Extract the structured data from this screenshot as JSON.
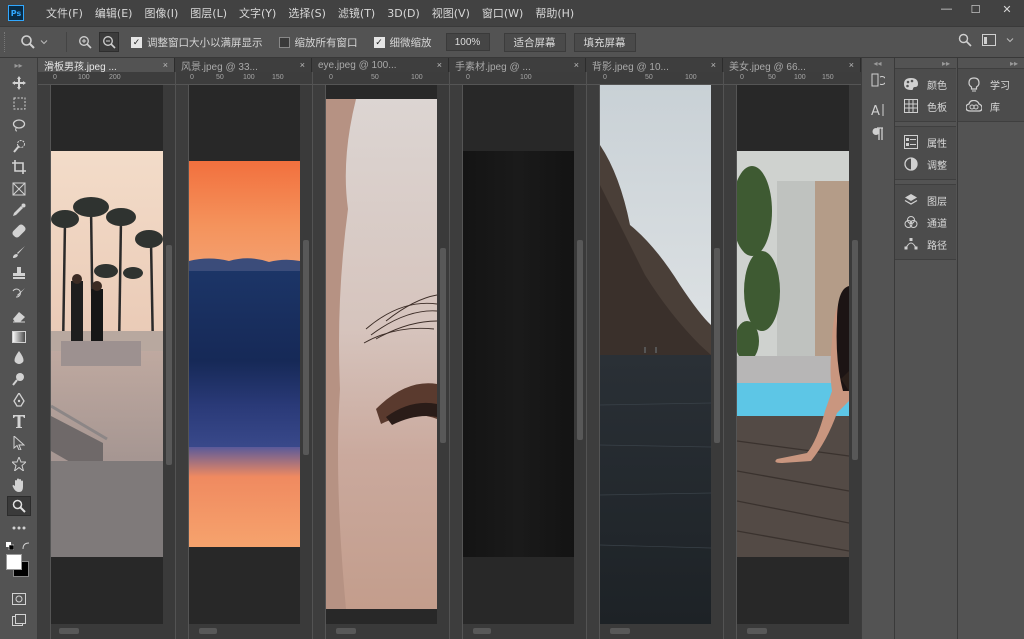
{
  "app": {
    "logo": "Ps"
  },
  "menu": [
    "文件(F)",
    "编辑(E)",
    "图像(I)",
    "图层(L)",
    "文字(Y)",
    "选择(S)",
    "滤镜(T)",
    "3D(D)",
    "视图(V)",
    "窗口(W)",
    "帮助(H)"
  ],
  "window_controls": {
    "minimize": "—",
    "maximize": "☐",
    "close": "✕"
  },
  "options": {
    "resize_windows_label": "调整窗口大小以满屏显示",
    "resize_windows_checked": true,
    "zoom_all_label": "缩放所有窗口",
    "zoom_all_checked": false,
    "scrubby_zoom_label": "细微缩放",
    "scrubby_zoom_checked": true,
    "zoom_value": "100%",
    "fit_screen": "适合屏幕",
    "fill_screen": "填充屏幕"
  },
  "tabs": [
    {
      "label": "滑板男孩.jpeg ...",
      "close": "×",
      "active": true
    },
    {
      "label": "风景.jpeg @ 33...",
      "close": "×",
      "active": false
    },
    {
      "label": "eye.jpeg @ 100...",
      "close": "×",
      "active": false
    },
    {
      "label": "手素材.jpeg @ ...",
      "close": "×",
      "active": false
    },
    {
      "label": "背影.jpeg @ 10...",
      "close": "×",
      "active": false
    },
    {
      "label": "美女.jpeg @ 66...",
      "close": "×",
      "active": false
    }
  ],
  "rulers": {
    "pane1": [
      "0",
      "100",
      "200"
    ],
    "pane2": [
      "0",
      "50",
      "100",
      "150"
    ],
    "pane3": [
      "0",
      "50",
      "100"
    ],
    "pane4": [
      "0",
      "100"
    ],
    "pane5": [
      "0",
      "50",
      "100"
    ],
    "pane6": [
      "0",
      "50",
      "100",
      "150"
    ]
  },
  "panels": {
    "column1": [
      "颜色",
      "色板",
      "属性",
      "调整",
      "图层",
      "通道",
      "路径"
    ],
    "column2": [
      "学习",
      "库"
    ]
  },
  "colors": {
    "accent": "#31a8ff",
    "panel_bg": "#535353",
    "canvas_bg": "#282828"
  }
}
